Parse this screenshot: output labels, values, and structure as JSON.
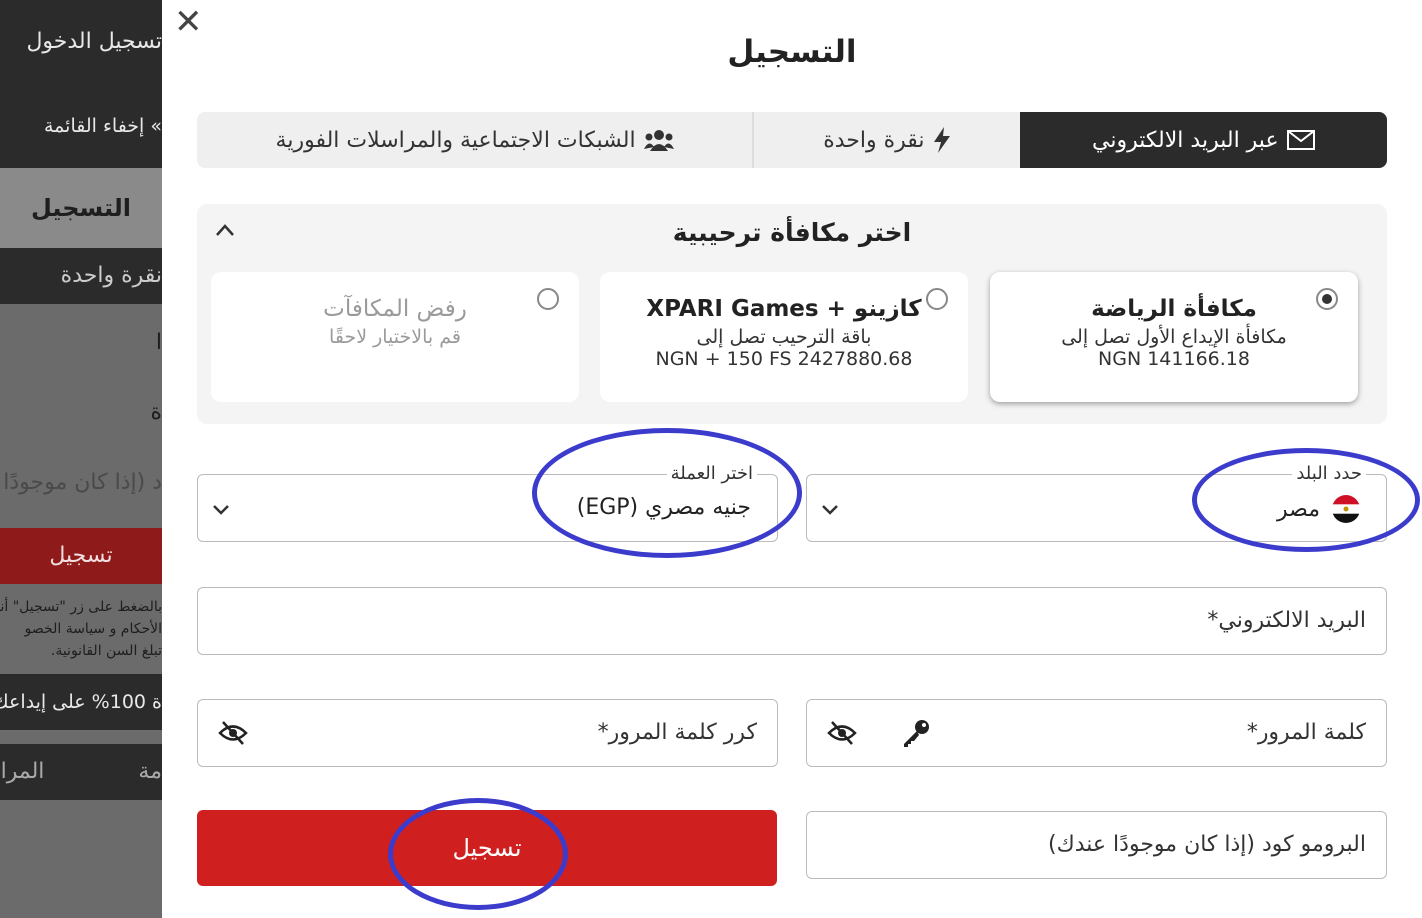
{
  "background": {
    "top_button": "تسجيل الدخول",
    "hide_menu": "» إخفاء القائمة",
    "heading": "التسجيل",
    "one_click": "نقرة واحدة",
    "line1": "ا",
    "line2": "ة",
    "promo_fragment": "د (إذا كان موجودًا",
    "register_button": "تسجيل",
    "terms_line1": "بالضغط على زر \"تسجيل\" أنك",
    "terms_line2": "الأحكام و سياسة الخصو",
    "terms_line3": "تبلغ السن القانونية.",
    "bonus_strip": "ة 100% على إيداعك",
    "bottom_tab_a": "المراه",
    "bottom_tab_b": "مة"
  },
  "modal": {
    "close": "✕",
    "title": "التسجيل",
    "tabs": [
      {
        "label": "عبر البريد الالكتروني",
        "icon": "envelope-icon",
        "active": true
      },
      {
        "label": "نقرة واحدة",
        "icon": "lightning-icon",
        "active": false
      },
      {
        "label": "الشبكات الاجتماعية والمراسلات الفورية",
        "icon": "users-icon",
        "active": false
      }
    ],
    "bonus": {
      "title": "اختر مكافأة ترحيبية",
      "cards": [
        {
          "title": "مكافأة الرياضة",
          "line1": "مكافأة الإيداع الأول تصل إلى",
          "line2": "NGN 141166.18",
          "selected": true
        },
        {
          "title": "كازينو + XPARI Games",
          "line1": "باقة الترحيب تصل إلى",
          "line2": "NGN + 150 FS 2427880.68",
          "selected": false
        },
        {
          "title": "رفض المكافآت",
          "line1": "قم بالاختيار لاحقًا",
          "line2": "",
          "selected": false
        }
      ]
    },
    "country": {
      "label": "حدد البلد",
      "value": "مصر",
      "flag_icon": "egypt-flag-icon"
    },
    "currency": {
      "label": "اختر العملة",
      "value": "جنيه مصري (EGP)"
    },
    "email": {
      "label": "البريد الالكتروني*"
    },
    "password": {
      "label": "كلمة المرور*"
    },
    "password_repeat": {
      "label": "كرر كلمة المرور*"
    },
    "promo": {
      "label": "البرومو كود (إذا كان موجودًا عندك)"
    },
    "submit_label": "تسجيل"
  },
  "colors": {
    "accent_red": "#d01f1f",
    "tab_active": "#2b2b2b",
    "annotation_ring": "#3c3ccc"
  }
}
